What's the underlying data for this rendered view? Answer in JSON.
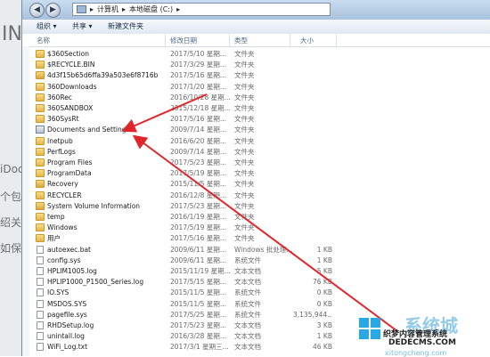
{
  "background": {
    "fragments": [
      "INT",
      "iDoc",
      "个包",
      "绍关",
      "如保护"
    ]
  },
  "window": {
    "breadcrumb": [
      "计算机",
      "本地磁盘 (C:)"
    ],
    "toolbar": {
      "organize": "组织 ▾",
      "share": "共享 ▾",
      "new_folder": "新建文件夹"
    },
    "columns": {
      "name": "名称",
      "date": "修改日期",
      "type": "类型",
      "size": "大小"
    },
    "files": [
      {
        "name": "$360Section",
        "date": "2017/5/10 星期...",
        "type": "文件夹",
        "size": "",
        "icon": "folder-icon"
      },
      {
        "name": "$RECYCLE.BIN",
        "date": "2017/3/29 星期...",
        "type": "文件夹",
        "size": "",
        "icon": "folder-icon"
      },
      {
        "name": "4d3f15b65d6ffa39a503e6f8716b",
        "date": "2017/5/16 星期...",
        "type": "文件夹",
        "size": "",
        "icon": "locked-folder-icon"
      },
      {
        "name": "360Downloads",
        "date": "2017/1/20 星期...",
        "type": "文件夹",
        "size": "",
        "icon": "folder-icon"
      },
      {
        "name": "360Rec",
        "date": "2016/10/28 星期...",
        "type": "文件夹",
        "size": "",
        "icon": "folder-icon"
      },
      {
        "name": "360SANDBOX",
        "date": "2015/12/18 星期...",
        "type": "文件夹",
        "size": "",
        "icon": "folder-icon"
      },
      {
        "name": "360SysRt",
        "date": "2017/5/16 星期...",
        "type": "文件夹",
        "size": "",
        "icon": "folder-icon"
      },
      {
        "name": "Documents and Settings",
        "date": "2009/7/14 星期...",
        "type": "文件夹",
        "size": "",
        "icon": "shortcut-folder-icon"
      },
      {
        "name": "Inetpub",
        "date": "2016/6/20 星期...",
        "type": "文件夹",
        "size": "",
        "icon": "folder-icon"
      },
      {
        "name": "PerfLogs",
        "date": "2009/7/14 星期...",
        "type": "文件夹",
        "size": "",
        "icon": "folder-icon"
      },
      {
        "name": "Program Files",
        "date": "2017/5/23 星期...",
        "type": "文件夹",
        "size": "",
        "icon": "folder-icon"
      },
      {
        "name": "ProgramData",
        "date": "2017/5/19 星期...",
        "type": "文件夹",
        "size": "",
        "icon": "folder-icon"
      },
      {
        "name": "Recovery",
        "date": "2015/11/5 星期...",
        "type": "文件夹",
        "size": "",
        "icon": "locked-folder-icon"
      },
      {
        "name": "RECYCLER",
        "date": "2016/12/8 星期...",
        "type": "文件夹",
        "size": "",
        "icon": "folder-icon"
      },
      {
        "name": "System Volume Information",
        "date": "2017/5/23 星期...",
        "type": "文件夹",
        "size": "",
        "icon": "locked-folder-icon"
      },
      {
        "name": "temp",
        "date": "2016/1/19 星期...",
        "type": "文件夹",
        "size": "",
        "icon": "folder-icon"
      },
      {
        "name": "Windows",
        "date": "2017/5/19 星期...",
        "type": "文件夹",
        "size": "",
        "icon": "folder-icon"
      },
      {
        "name": "用户",
        "date": "2017/5/16 星期...",
        "type": "文件夹",
        "size": "",
        "icon": "folder-icon"
      },
      {
        "name": "autoexec.bat",
        "date": "2009/6/11 星期...",
        "type": "Windows 批处理...",
        "size": "1 KB",
        "icon": "file-icon"
      },
      {
        "name": "config.sys",
        "date": "2009/6/11 星期...",
        "type": "系统文件",
        "size": "1 KB",
        "icon": "file-icon"
      },
      {
        "name": "HPLIM1005.log",
        "date": "2015/11/19 星期...",
        "type": "文本文档",
        "size": "5 KB",
        "icon": "file-icon"
      },
      {
        "name": "HPLIP1000_P1500_Series.log",
        "date": "2017/5/15 星期...",
        "type": "文本文档",
        "size": "76 KB",
        "icon": "file-icon"
      },
      {
        "name": "IO.SYS",
        "date": "2015/11/5 星期...",
        "type": "系统文件",
        "size": "0 KB",
        "icon": "file-icon"
      },
      {
        "name": "MSDOS.SYS",
        "date": "2015/11/5 星期...",
        "type": "系统文件",
        "size": "0 KB",
        "icon": "file-icon"
      },
      {
        "name": "pagefile.sys",
        "date": "2017/5/25 星期...",
        "type": "系统文件",
        "size": "3,135,944...",
        "icon": "file-icon"
      },
      {
        "name": "RHDSetup.log",
        "date": "2017/5/23 星期...",
        "type": "文本文档",
        "size": "3 KB",
        "icon": "file-icon"
      },
      {
        "name": "unintall.log",
        "date": "2016/3/28 星期...",
        "type": "文本文档",
        "size": "1 KB",
        "icon": "file-icon"
      },
      {
        "name": "WiFi_Log.txt",
        "date": "2017/3/1 星期三...",
        "type": "文本文档",
        "size": "46 KB",
        "icon": "file-icon"
      }
    ]
  },
  "annotation": {
    "arrow_color": "#e0262b"
  },
  "watermark": {
    "text_big": "系统城",
    "text_site": "织梦内容管理系统",
    "text_url": "DEDECMS.COM",
    "text_bottom": "xitongcheng.com"
  }
}
